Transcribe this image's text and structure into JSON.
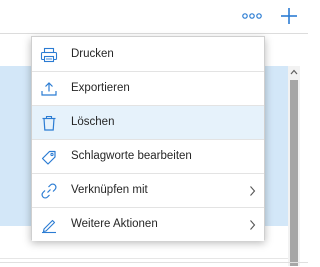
{
  "toolbar": {
    "more_icon": "more-horizontal-icon",
    "add_icon": "plus-icon",
    "accent": "#2b7cd3"
  },
  "menu": {
    "items": [
      {
        "label": "Drucken",
        "icon": "printer-icon",
        "submenu": false
      },
      {
        "label": "Exportieren",
        "icon": "export-upload-icon",
        "submenu": false
      },
      {
        "label": "Löschen",
        "icon": "trash-icon",
        "submenu": false,
        "highlighted": true
      },
      {
        "label": "Schlagworte bearbeiten",
        "icon": "tag-icon",
        "submenu": false
      },
      {
        "label": "Verknüpfen mit",
        "icon": "link-icon",
        "submenu": true
      },
      {
        "label": "Weitere Aktionen",
        "icon": "pen-icon",
        "submenu": true
      }
    ]
  },
  "colors": {
    "selection": "#d3e7f8",
    "hover": "#e6f2fb",
    "icon_blue": "#2b7cd3"
  }
}
